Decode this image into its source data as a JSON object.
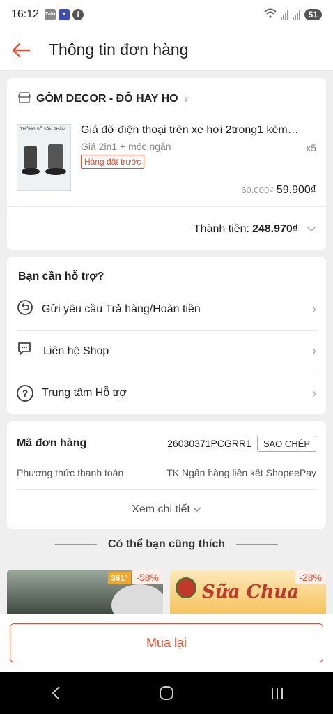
{
  "status": {
    "time": "16:12",
    "zalo": "Zalo",
    "battery": "51"
  },
  "header": {
    "title": "Thông tin đơn hàng"
  },
  "order": {
    "shop_name": "GÔM DECOR - ĐÔ HAY HO",
    "product": {
      "name": "Giá đỡ điện thoại trên xe hơi 2trong1 kèm móc ngắn",
      "variant": "Giá 2in1 + móc ngắn",
      "quantity": "x5",
      "tag": "Hàng đặt trước",
      "old_price": "60.000₫",
      "price": "59.900₫",
      "thumb_title": "THÔNG SỐ SẢN PHẨM"
    },
    "total_label": "Thành tiền:",
    "total_amount": "248.970₫"
  },
  "help": {
    "title": "Bạn cần hỗ trợ?",
    "items": [
      {
        "label": "Gửi yêu cầu Trả hàng/Hoàn tiền",
        "icon": "return-icon"
      },
      {
        "label": "Liên hệ Shop",
        "icon": "chat-icon"
      },
      {
        "label": "Trung tâm Hỗ trợ",
        "icon": "help-icon"
      }
    ]
  },
  "order_info": {
    "id_label": "Mã đơn hàng",
    "id_value": "26030371PCGRR1",
    "copy_label": "SAO CHÉP",
    "payment_label": "Phương thức thanh toán",
    "payment_value": "TK Ngân hàng liên kết ShopeePay",
    "detail_label": "Xem chi tiết"
  },
  "suggest": {
    "title": "Có thể bạn cũng thích",
    "items": [
      {
        "discount": "-58%",
        "brand": "361°"
      },
      {
        "discount": "-28%",
        "text": "Sữa Chua"
      }
    ]
  },
  "footer": {
    "buy_again": "Mua lại"
  },
  "colors": {
    "accent": "#ee4d2d",
    "background": "#efefef"
  }
}
